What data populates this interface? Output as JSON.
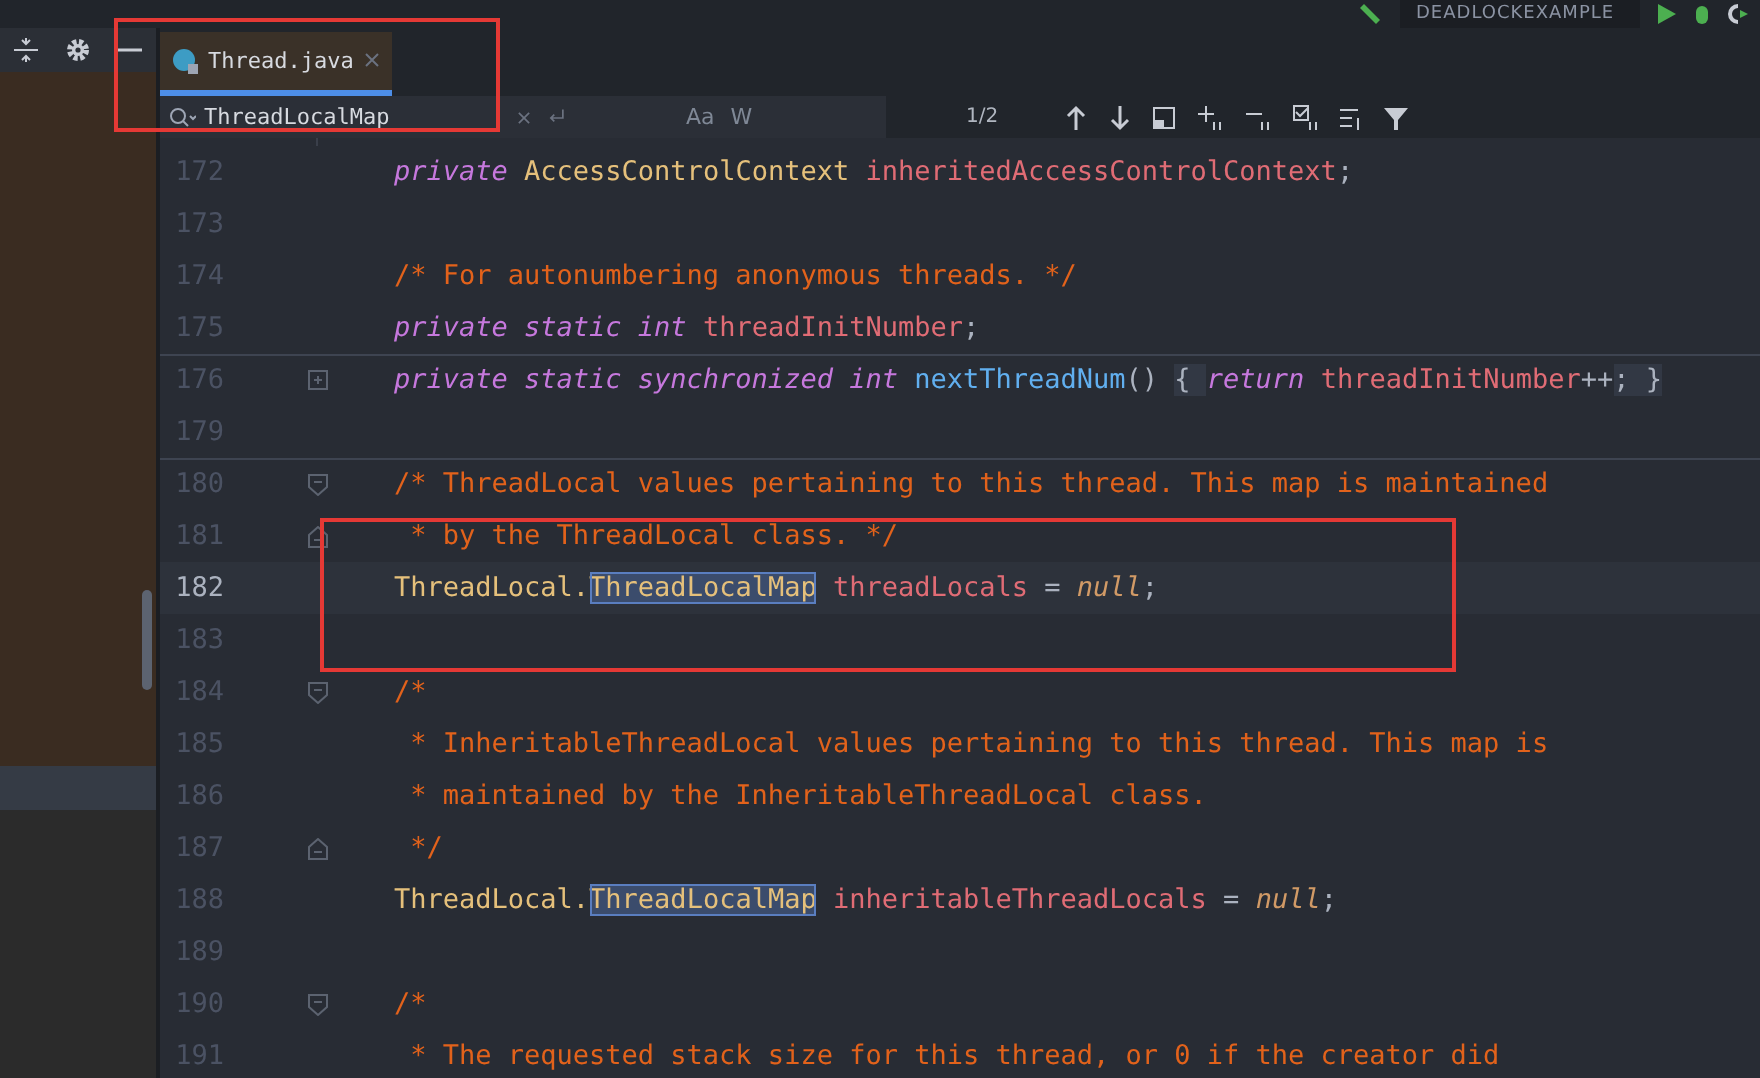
{
  "run_config": {
    "name": "DEADLOCKEXAMPLE"
  },
  "tabs": [
    {
      "label": "Thread.java",
      "selected": true,
      "framed": true
    }
  ],
  "search": {
    "value": "ThreadLocalMap",
    "options": [
      "Aa",
      "W"
    ],
    "match_count": "1/2"
  },
  "code_lines": [
    {
      "number": "172",
      "current": false,
      "divider_above": false,
      "framed": false,
      "tokens": [
        {
          "kind": "kw",
          "text": "private"
        },
        {
          "kind": "type",
          "text": " AccessControlContext"
        },
        {
          "kind": "field",
          "text": " inheritedAccessControlContext"
        },
        {
          "kind": "plain",
          "text": ";"
        }
      ]
    },
    {
      "number": "173",
      "current": false,
      "divider_above": false,
      "framed": false
    },
    {
      "number": "174",
      "current": false,
      "divider_above": false,
      "framed": false,
      "tokens": [
        {
          "kind": "comment",
          "text": "/* For autonumbering anonymous threads. */"
        }
      ]
    },
    {
      "number": "175",
      "current": false,
      "divider_above": false,
      "framed": false,
      "tokens": [
        {
          "kind": "kw",
          "text": "private static int"
        },
        {
          "kind": "field",
          "text": " threadInitNumber"
        },
        {
          "kind": "plain",
          "text": ";"
        }
      ]
    },
    {
      "number": "176",
      "current": false,
      "divider_above": true,
      "framed": false,
      "gutter_icon": {
        "kind": "folded"
      },
      "tokens": [
        {
          "kind": "kw",
          "text": "private static synchronized int"
        },
        {
          "kind": "method",
          "text": " nextThreadNum"
        },
        {
          "kind": "plain",
          "text": "() "
        },
        {
          "kind": "brace",
          "text": "{ "
        },
        {
          "kind": "kw",
          "text": "return"
        },
        {
          "kind": "field",
          "text": " threadInitNumber"
        },
        {
          "kind": "plain",
          "text": "++"
        },
        {
          "kind": "brace",
          "text": "; }"
        }
      ]
    },
    {
      "number": "179",
      "current": false,
      "divider_above": false,
      "framed": false
    },
    {
      "number": "180",
      "current": false,
      "divider_above": true,
      "framed": false,
      "gutter_icon": {
        "kind": "fold_start"
      },
      "tokens": [
        {
          "kind": "comment",
          "text": "/* ThreadLocal values pertaining to this thread. This map is maintained"
        }
      ]
    },
    {
      "number": "181",
      "current": false,
      "divider_above": false,
      "framed": true,
      "gutter_icon": {
        "kind": "fold_end"
      },
      "tokens": [
        {
          "kind": "comment",
          "text": " * by the ThreadLocal class. */"
        }
      ]
    },
    {
      "number": "182",
      "current": true,
      "divider_above": false,
      "framed": true,
      "tokens": [
        {
          "kind": "type",
          "text": "ThreadLocal."
        },
        {
          "kind": "match",
          "text": "ThreadLocalMap"
        },
        {
          "kind": "field",
          "text": " threadLocals"
        },
        {
          "kind": "plain",
          "text": " = "
        },
        {
          "kind": "null",
          "text": "null"
        },
        {
          "kind": "plain",
          "text": ";"
        }
      ]
    },
    {
      "number": "183",
      "current": false,
      "divider_above": false,
      "framed": true
    },
    {
      "number": "184",
      "current": false,
      "divider_above": false,
      "framed": false,
      "gutter_icon": {
        "kind": "fold_start"
      },
      "tokens": [
        {
          "kind": "comment",
          "text": "/*"
        }
      ]
    },
    {
      "number": "185",
      "current": false,
      "divider_above": false,
      "framed": false,
      "tokens": [
        {
          "kind": "comment",
          "text": " * InheritableThreadLocal values pertaining to this thread. This map is"
        }
      ]
    },
    {
      "number": "186",
      "current": false,
      "divider_above": false,
      "framed": false,
      "tokens": [
        {
          "kind": "comment",
          "text": " * maintained by the InheritableThreadLocal class."
        }
      ]
    },
    {
      "number": "187",
      "current": false,
      "divider_above": false,
      "framed": false,
      "gutter_icon": {
        "kind": "fold_end"
      },
      "tokens": [
        {
          "kind": "comment",
          "text": " */"
        }
      ]
    },
    {
      "number": "188",
      "current": false,
      "divider_above": false,
      "framed": false,
      "tokens": [
        {
          "kind": "type",
          "text": "ThreadLocal."
        },
        {
          "kind": "match",
          "text": "ThreadLocalMap"
        },
        {
          "kind": "field",
          "text": " inheritableThreadLocals"
        },
        {
          "kind": "plain",
          "text": " = "
        },
        {
          "kind": "null",
          "text": "null"
        },
        {
          "kind": "plain",
          "text": ";"
        }
      ]
    },
    {
      "number": "189",
      "current": false,
      "divider_above": false,
      "framed": false
    },
    {
      "number": "190",
      "current": false,
      "divider_above": false,
      "framed": false,
      "gutter_icon": {
        "kind": "fold_start"
      },
      "tokens": [
        {
          "kind": "comment",
          "text": "/*"
        }
      ]
    },
    {
      "number": "191",
      "current": false,
      "divider_above": false,
      "framed": false,
      "tokens": [
        {
          "kind": "comment",
          "text": " * The requested stack size for this thread, or 0 if the creator did"
        }
      ]
    }
  ]
}
